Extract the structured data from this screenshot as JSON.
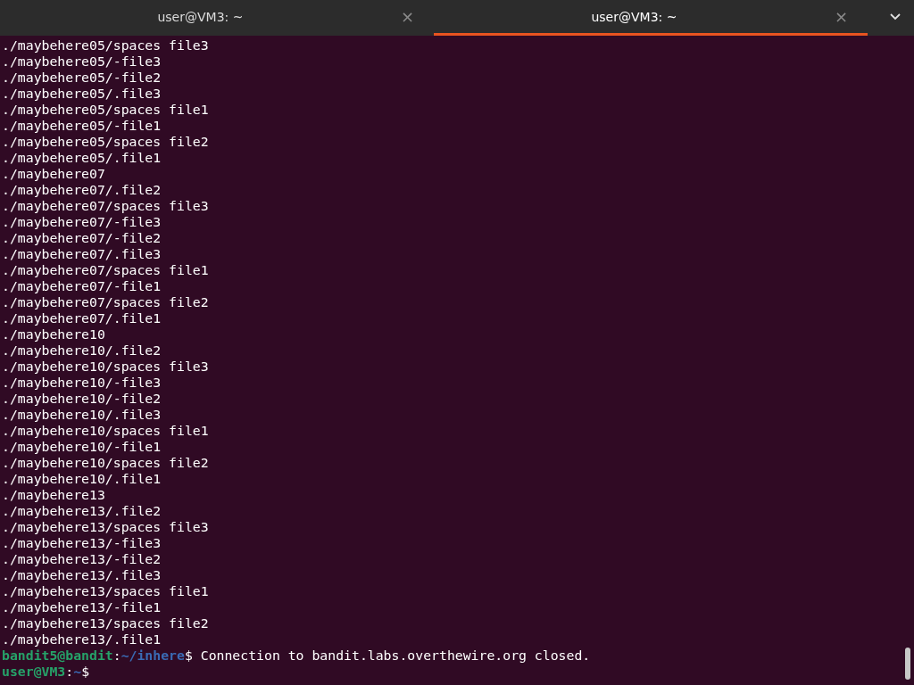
{
  "tabs": [
    {
      "title": "user@VM3: ~",
      "close": "×",
      "selected": false
    },
    {
      "title": "user@VM3: ~",
      "close": "×",
      "selected": true
    }
  ],
  "terminal": {
    "lines": [
      {
        "kind": "output",
        "text": "./maybehere05/spaces file3"
      },
      {
        "kind": "output",
        "text": "./maybehere05/-file3"
      },
      {
        "kind": "output",
        "text": "./maybehere05/-file2"
      },
      {
        "kind": "output",
        "text": "./maybehere05/.file3"
      },
      {
        "kind": "output",
        "text": "./maybehere05/spaces file1"
      },
      {
        "kind": "output",
        "text": "./maybehere05/-file1"
      },
      {
        "kind": "output",
        "text": "./maybehere05/spaces file2"
      },
      {
        "kind": "output",
        "text": "./maybehere05/.file1"
      },
      {
        "kind": "output",
        "text": "./maybehere07"
      },
      {
        "kind": "output",
        "text": "./maybehere07/.file2"
      },
      {
        "kind": "output",
        "text": "./maybehere07/spaces file3"
      },
      {
        "kind": "output",
        "text": "./maybehere07/-file3"
      },
      {
        "kind": "output",
        "text": "./maybehere07/-file2"
      },
      {
        "kind": "output",
        "text": "./maybehere07/.file3"
      },
      {
        "kind": "output",
        "text": "./maybehere07/spaces file1"
      },
      {
        "kind": "output",
        "text": "./maybehere07/-file1"
      },
      {
        "kind": "output",
        "text": "./maybehere07/spaces file2"
      },
      {
        "kind": "output",
        "text": "./maybehere07/.file1"
      },
      {
        "kind": "output",
        "text": "./maybehere10"
      },
      {
        "kind": "output",
        "text": "./maybehere10/.file2"
      },
      {
        "kind": "output",
        "text": "./maybehere10/spaces file3"
      },
      {
        "kind": "output",
        "text": "./maybehere10/-file3"
      },
      {
        "kind": "output",
        "text": "./maybehere10/-file2"
      },
      {
        "kind": "output",
        "text": "./maybehere10/.file3"
      },
      {
        "kind": "output",
        "text": "./maybehere10/spaces file1"
      },
      {
        "kind": "output",
        "text": "./maybehere10/-file1"
      },
      {
        "kind": "output",
        "text": "./maybehere10/spaces file2"
      },
      {
        "kind": "output",
        "text": "./maybehere10/.file1"
      },
      {
        "kind": "output",
        "text": "./maybehere13"
      },
      {
        "kind": "output",
        "text": "./maybehere13/.file2"
      },
      {
        "kind": "output",
        "text": "./maybehere13/spaces file3"
      },
      {
        "kind": "output",
        "text": "./maybehere13/-file3"
      },
      {
        "kind": "output",
        "text": "./maybehere13/-file2"
      },
      {
        "kind": "output",
        "text": "./maybehere13/.file3"
      },
      {
        "kind": "output",
        "text": "./maybehere13/spaces file1"
      },
      {
        "kind": "output",
        "text": "./maybehere13/-file1"
      },
      {
        "kind": "output",
        "text": "./maybehere13/spaces file2"
      },
      {
        "kind": "output",
        "text": "./maybehere13/.file1"
      },
      {
        "kind": "prompt",
        "user": "bandit5@bandit",
        "separator": ":",
        "path": "~/inhere",
        "symbol": "$",
        "command": "Connection to bandit.labs.overthewire.org closed."
      },
      {
        "kind": "prompt",
        "user": "user@VM3",
        "separator": ":",
        "path": "~",
        "symbol": "$"
      }
    ]
  }
}
